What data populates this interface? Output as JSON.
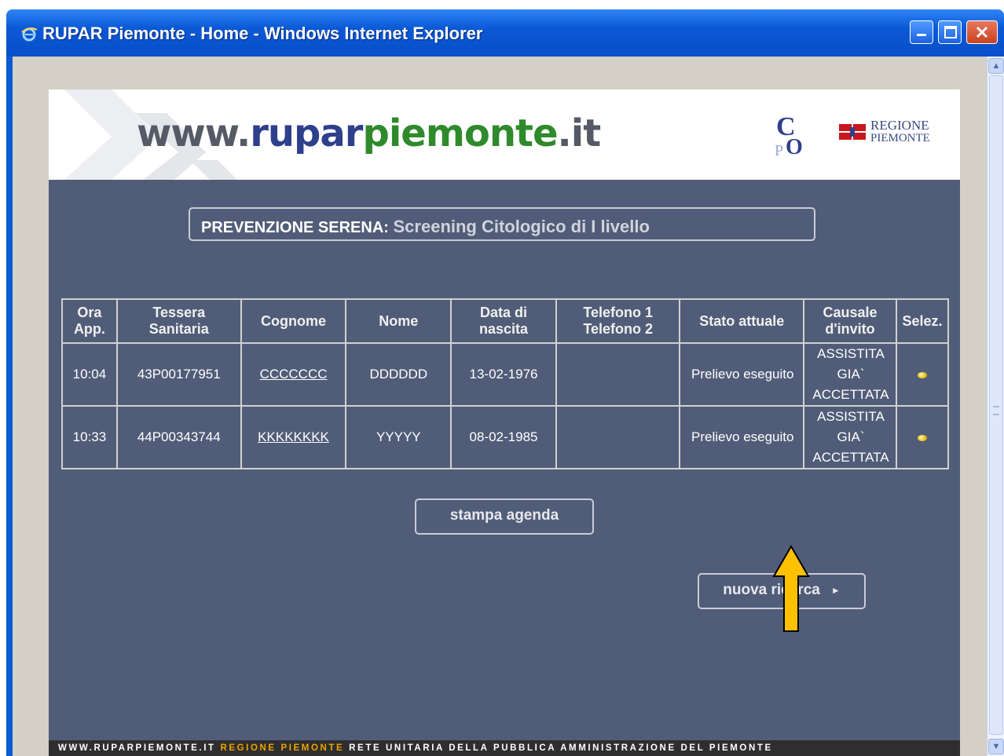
{
  "window": {
    "title": "RUPAR Piemonte - Home - Windows Internet Explorer"
  },
  "header": {
    "logo": {
      "www": "www.",
      "rupar": "rupar",
      "piemonte": "piemonte",
      "it": ".it"
    },
    "cpo_logo": "CPO",
    "regione": {
      "line1": "REGIONE",
      "line2": "PIEMONTE"
    }
  },
  "page_title": {
    "strong": "PREVENZIONE SERENA:",
    "light": "Screening Citologico di I livello"
  },
  "table": {
    "headers": {
      "ora": [
        "Ora",
        "App."
      ],
      "tessera": [
        "Tessera",
        "Sanitaria"
      ],
      "cognome": "Cognome",
      "nome": "Nome",
      "data": [
        "Data di",
        "nascita"
      ],
      "telefono": [
        "Telefono 1",
        "Telefono 2"
      ],
      "stato": "Stato attuale",
      "causale": [
        "Causale",
        "d'invito"
      ],
      "selez": "Selez."
    },
    "rows": [
      {
        "ora": "10:04",
        "tessera": "43P00177951",
        "cognome": "CCCCCCC",
        "nome": "DDDDDD",
        "data": "13-02-1976",
        "telefono": "",
        "stato": "Prelievo eseguito",
        "causale": [
          "ASSISTITA",
          "GIA`",
          "ACCETTATA"
        ]
      },
      {
        "ora": "10:33",
        "tessera": "44P00343744",
        "cognome": "KKKKKKKK",
        "nome": "YYYYY",
        "data": "08-02-1985",
        "telefono": "",
        "stato": "Prelievo eseguito",
        "causale": [
          "ASSISTITA",
          "GIA`",
          "ACCETTATA"
        ]
      }
    ]
  },
  "buttons": {
    "stampa": "stampa agenda",
    "nuova": "nuova ricerca",
    "nuova_arrow": "►"
  },
  "footer": {
    "part1": "WWW.RUPARPIEMONTE.IT",
    "part2": "REGIONE PIEMONTE",
    "part3": "RETE UNITARIA DELLA PUBBLICA AMMINISTRAZIONE DEL PIEMONTE"
  },
  "colors": {
    "page_bg": "#515d78",
    "annotation_arrow": "#ffc000",
    "titlebar": "#0b58d6"
  },
  "icons": [
    "ie-logo-icon",
    "minimize-icon",
    "maximize-icon",
    "close-icon",
    "scroll-up-icon",
    "scroll-down-icon",
    "selection-dot-icon",
    "annotation-arrow-icon"
  ]
}
